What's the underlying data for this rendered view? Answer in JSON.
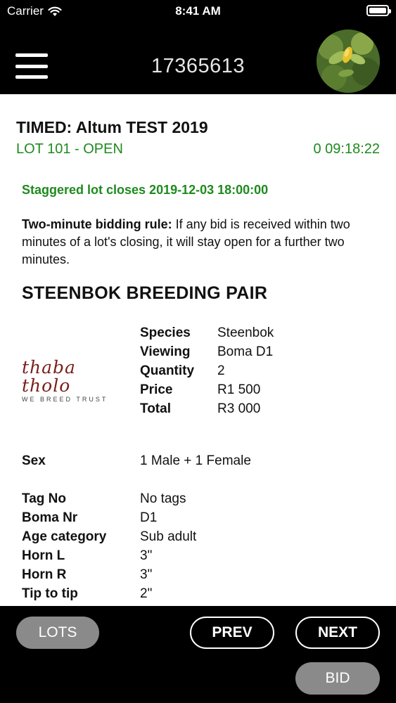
{
  "status_bar": {
    "carrier": "Carrier",
    "time": "8:41 AM"
  },
  "nav": {
    "title": "17365613",
    "menu_icon": "hamburger-menu-icon",
    "avatar_icon": "profile-avatar"
  },
  "auction": {
    "title": "TIMED: Altum TEST 2019",
    "lot_status": "LOT 101 - OPEN",
    "countdown": "0 09:18:22",
    "closes": "Staggered lot closes 2019-12-03 18:00:00",
    "rule_label": "Two-minute bidding rule:",
    "rule_text": " If any bid is received within two minutes of a lot's closing, it will stay open for a further two minutes."
  },
  "lot": {
    "name": "STEENBOK BREEDING PAIR",
    "logo": {
      "main": "thaba tholo",
      "tagline": "WE BREED TRUST"
    },
    "specs": [
      {
        "label": "Species",
        "value": "Steenbok"
      },
      {
        "label": "Viewing",
        "value": "Boma D1"
      },
      {
        "label": "Quantity",
        "value": "2"
      },
      {
        "label": "Price",
        "value": "R1 500"
      },
      {
        "label": "Total",
        "value": "R3 000"
      }
    ],
    "details": [
      {
        "label": "Sex",
        "value": "1 Male + 1 Female"
      },
      {
        "label": "Tag No",
        "value": "No tags"
      },
      {
        "label": "Boma Nr",
        "value": "D1"
      },
      {
        "label": "Age category",
        "value": "Sub adult"
      },
      {
        "label": "Horn L",
        "value": "3\""
      },
      {
        "label": "Horn R",
        "value": "3\""
      },
      {
        "label": "Tip to tip",
        "value": "2\""
      }
    ]
  },
  "buttons": {
    "lots": "LOTS",
    "prev": "PREV",
    "next": "NEXT",
    "bid": "BID"
  },
  "colors": {
    "accent_green": "#1e8a1e",
    "bar_background": "#000000",
    "pill_gray": "#8a8a8a",
    "logo_red": "#7a1f1a"
  }
}
